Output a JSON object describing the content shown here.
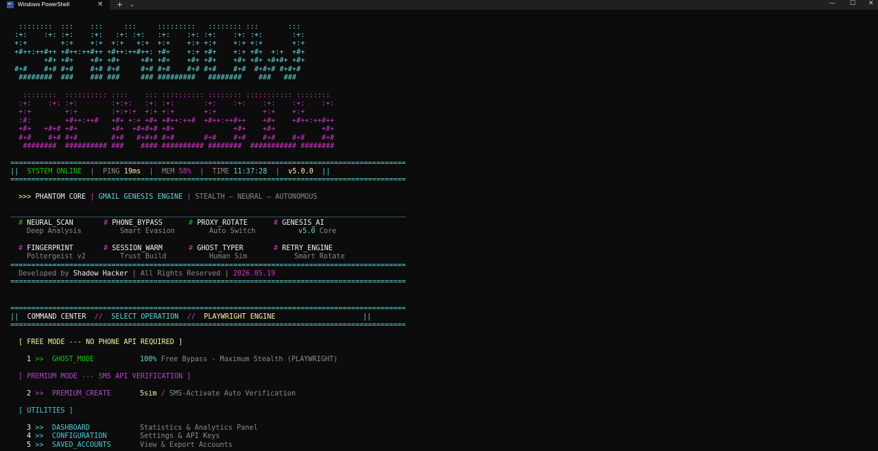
{
  "window": {
    "tab_title": "Windows PowerShell",
    "tab_close": "✕",
    "new_tab": "+",
    "tab_dropdown": "⌄",
    "minimize": "—",
    "maximize": "☐",
    "close": "✕"
  },
  "banner": {
    "rows_cyan": [
      "  ::::::::  :::    :::     :::     :::::::::   :::::::: :::       :::",
      " :+:    :+: :+:    :+:   :+: :+:   :+:    :+: :+:    :+: :+:       :+:",
      " +:+        +:+    +:+  +:+   +:+  +:+    +:+ +:+    +:+ +:+       +:+",
      " +#++:++#++ +#++:++#++ +#++:++#++: +#+    +:+ +#+    +:+ +#+  +:+  +#+",
      "        +#+ +#+    +#+ +#+     +#+ +#+    +#+ +#+    +#+ +#+ +#+#+ +#+",
      " #+#    #+# #+#    #+# #+#     #+# #+#    #+# #+#    #+#  #+#+# #+#+#",
      "  ########  ###    ### ###     ### #########   ########    ###   ###"
    ],
    "rows_magenta": [
      "   ::::::::  :::::::::: ::::    ::: :::::::::: :::::::: ::::::::::: ::::::::",
      "  :+:    :+: :+:        :+:+:   :+: :+:       :+:    :+:    :+:    :+:    :+:",
      "  +:+        +:+        :+:+:+  +:+ +:+       +:+           +:+    +:+",
      "  :#:        +#++:++#   +#+ +:+ +#+ +#++:++#  +#++:++#++    +#+    +#++:++#++",
      "  +#+   +#+# +#+        +#+  +#+#+# +#+              +#+    +#+           +#+",
      "  #+#    #+# #+#        #+#   #+#+# #+#       #+#    #+#    #+#    #+#    #+#",
      "   ########  ########## ###    #### ########## ########  ########### ########"
    ]
  },
  "status_bar": {
    "frame_left": "||",
    "frame_right": "||",
    "sep": "|",
    "online": "SYSTEM ONLINE",
    "ping_label": "PING",
    "ping_value": "19ms",
    "mem_label": "MEM",
    "mem_value": "58%",
    "time_label": "TIME",
    "time_value": "11:37:28",
    "version": "v5.0.0"
  },
  "tagline": {
    "prompt": ">>>",
    "product": "PHANTOM CORE",
    "sep": "|",
    "engine": "GMAIL GENESIS ENGINE",
    "features": "STEALTH — NEURAL — AUTONOMOUS"
  },
  "modules": {
    "hash": "#",
    "row1": [
      {
        "name": "NEURAL_SCAN",
        "desc": "Deep Analysis"
      },
      {
        "name": "PHONE_BYPASS",
        "desc": "Smart Evasion"
      },
      {
        "name": "PROXY_ROTATE",
        "desc": "Auto Switch"
      },
      {
        "name": "GENESIS_AI",
        "desc_accent": "v5.0",
        "desc": "Core"
      }
    ],
    "row2": [
      {
        "name": "FINGERPRINT",
        "desc": "Poltergeist v2"
      },
      {
        "name": "SESSION_WARM",
        "desc": "Trust Build"
      },
      {
        "name": "GHOST_TYPER",
        "desc": "Human Sim"
      },
      {
        "name": "RETRY_ENGINE",
        "desc": "Smart Rotate"
      }
    ]
  },
  "credits": {
    "prefix": "Developed by",
    "author": "Shadow Hacker",
    "sep": "|",
    "rights": "All Rights Reserved",
    "date": "2026.05.19"
  },
  "command_center": {
    "frame_left": "||",
    "frame_right": "||",
    "title": "COMMAND CENTER",
    "slashes": "//",
    "select": "SELECT OPERATION",
    "engine": "PLAYWRIGHT ENGINE"
  },
  "sections": {
    "free": "[ FREE MODE --- NO PHONE API REQUIRED ]",
    "premium": "[ PREMIUM MODE --- SMS API VERIFICATION ]",
    "utilities": "[ UTILITIES ]"
  },
  "menu": {
    "arrow": ">>",
    "item1": {
      "num": "1",
      "label": "GHOST_MODE",
      "desc_accent": "100%",
      "desc": "Free Bypass - Maximum Stealth (PLAYWRIGHT)"
    },
    "item2": {
      "num": "2",
      "label": "PREMIUM_CREATE",
      "desc_accent": "5sim",
      "desc_sep": "/",
      "desc": "SMS-Activate Auto Verification"
    },
    "item3": {
      "num": "3",
      "label": "DASHBOARD",
      "desc": "Statistics & Analytics Panel"
    },
    "item4": {
      "num": "4",
      "label": "CONFIGURATION",
      "desc": "Settings & API Keys"
    },
    "item5": {
      "num": "5",
      "label": "SAVED_ACCOUNTS",
      "desc": "View & Export Accounts"
    }
  },
  "dividers": {
    "double": "==============================================================================================",
    "single": "______________________________________________________________________________________________"
  },
  "colors": {
    "background": "#0c0c0c",
    "cyan": "#61d6d6",
    "magenta": "#c839c5",
    "green": "#16c60c",
    "yellow": "#f9f1a5"
  }
}
